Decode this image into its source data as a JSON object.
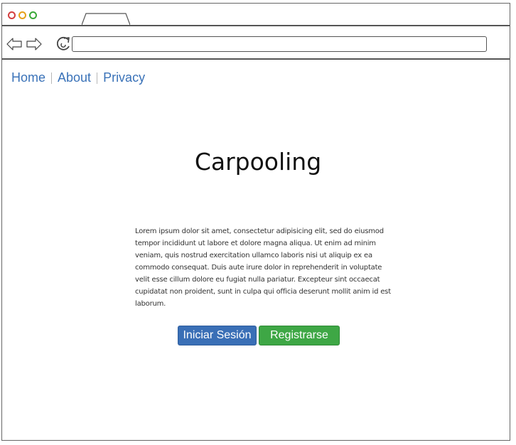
{
  "browser": {
    "url_value": "",
    "icons": {
      "back": "left-arrow-icon",
      "forward": "right-arrow-icon",
      "reload": "reload-icon"
    }
  },
  "nav": {
    "home": "Home",
    "about": "About",
    "privacy": "Privacy"
  },
  "main": {
    "title": "Carpooling",
    "body_text": "Lorem ipsum dolor sit amet, consectetur adipisicing elit, sed do eiusmod tempor incididunt ut labore et dolore magna aliqua. Ut enim ad minim veniam, quis nostrud exercitation ullamco laboris nisi ut aliquip ex ea commodo consequat. Duis aute irure dolor in reprehenderit in voluptate velit esse cillum dolore eu fugiat nulla pariatur. Excepteur sint occaecat cupidatat non proident, sunt in culpa qui officia deserunt mollit anim id est laborum."
  },
  "buttons": {
    "login": "Iniciar Sesión",
    "register": "Registrarse"
  },
  "colors": {
    "link": "#3a72b8",
    "login_button": "#3a6fb6",
    "register_button": "#3ea745"
  }
}
